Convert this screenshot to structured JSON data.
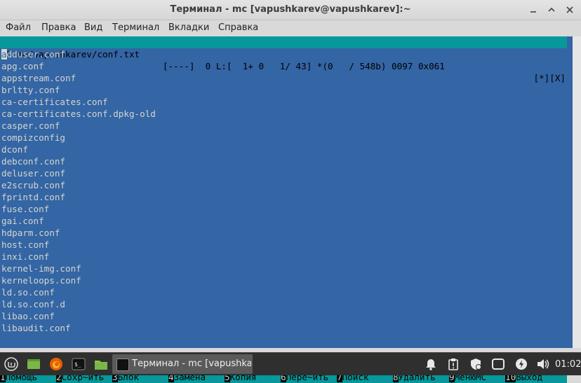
{
  "window": {
    "title": "Терминал - mc [vapushkarev@vapushkarev]:~"
  },
  "menu": [
    {
      "label": "Файл"
    },
    {
      "label": "Правка"
    },
    {
      "label": "Вид"
    },
    {
      "label": "Терминал"
    },
    {
      "label": "Вкладки"
    },
    {
      "label": "Справка"
    }
  ],
  "editor": {
    "path": "/home/vapushkarev/conf.txt",
    "info": "[----]  0 L:[  1+ 0   1/ 43] *(0   / 548b) 0097 0x061",
    "flags": "[*][X]",
    "cursor_char": "a",
    "first_line_rest": "dduser.conf",
    "lines": [
      "apg.conf",
      "appstream.conf",
      "brltty.conf",
      "ca-certificates.conf",
      "ca-certificates.conf.dpkg-old",
      "casper.conf",
      "compizconfig",
      "dconf",
      "debconf.conf",
      "deluser.conf",
      "e2scrub.conf",
      "fprintd.conf",
      "fuse.conf",
      "gai.conf",
      "hdparm.conf",
      "host.conf",
      "inxi.conf",
      "kernel-img.conf",
      "kerneloops.conf",
      "ld.so.conf",
      "ld.so.conf.d",
      "libao.conf",
      "libaudit.conf"
    ]
  },
  "fkeys": [
    {
      "num": "1",
      "label": "Помощь"
    },
    {
      "num": "2",
      "label": "Сохр~ить"
    },
    {
      "num": "3",
      "label": "Блок"
    },
    {
      "num": "4",
      "label": "Замена"
    },
    {
      "num": "5",
      "label": "Копия"
    },
    {
      "num": "6",
      "label": "Пере~ить"
    },
    {
      "num": "7",
      "label": "Поиск"
    },
    {
      "num": "8",
      "label": "Удалить"
    },
    {
      "num": "9",
      "label": "МенюMC"
    },
    {
      "num": "10",
      "label": "Выход"
    }
  ],
  "taskbar": {
    "task_label": "Терминал - mc [vapushka...",
    "clock": "01:02"
  },
  "colors": {
    "terminal_bg": "#3465a4",
    "status_bg": "#06989a",
    "text": "#d3d7cf",
    "taskbar_bg": "#2f2f2f"
  },
  "icons": {
    "menu": "mint-menu-icon",
    "files": "folder-icon",
    "firefox": "firefox-icon",
    "terminal": "terminal-icon",
    "tray": [
      "bell-icon",
      "clipboard-icon",
      "shield-icon",
      "window-icon",
      "power-icon",
      "volume-icon"
    ]
  }
}
